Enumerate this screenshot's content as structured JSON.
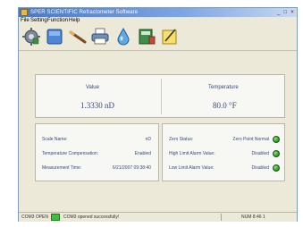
{
  "window": {
    "title": "SPER SCIENTIFIC Refractometer Software",
    "controls": [
      "_",
      "□",
      "×"
    ]
  },
  "menu": {
    "items": [
      "File",
      "Setting",
      "Function",
      "Help"
    ]
  },
  "toolbar": {
    "buttons": [
      {
        "icon": "gear-icon"
      },
      {
        "icon": "blue-panel-icon"
      },
      {
        "icon": "pen-icon"
      },
      {
        "icon": "printer-icon"
      },
      {
        "icon": "water-drop-icon"
      },
      {
        "icon": "book-icon"
      },
      {
        "icon": "note-pencil-icon"
      }
    ]
  },
  "readout": {
    "value_label": "Value",
    "value": "1.3330 nD",
    "temperature_label": "Temperature",
    "temperature": "80.0 °F"
  },
  "settings": {
    "rows": [
      {
        "label": "Scale Name:",
        "value": "nD"
      },
      {
        "label": "Temperature Compensation:",
        "value": "Enabled"
      },
      {
        "label": "Measurement Time:",
        "value": "6/21/2007 09:38:40"
      }
    ]
  },
  "status": {
    "rows": [
      {
        "label": "Zero Status:",
        "value": "Zero Point Normal"
      },
      {
        "label": "High Limit Alarm Value:",
        "value": "Disabled"
      },
      {
        "label": "Low Limit Alarm Value:",
        "value": "Disabled"
      }
    ],
    "led_color": "#2f9a2a"
  },
  "statusbar": {
    "port": "COM3 OPEN",
    "message": "COM3 opened successfully!",
    "caps": "NUM 8:46 1"
  }
}
